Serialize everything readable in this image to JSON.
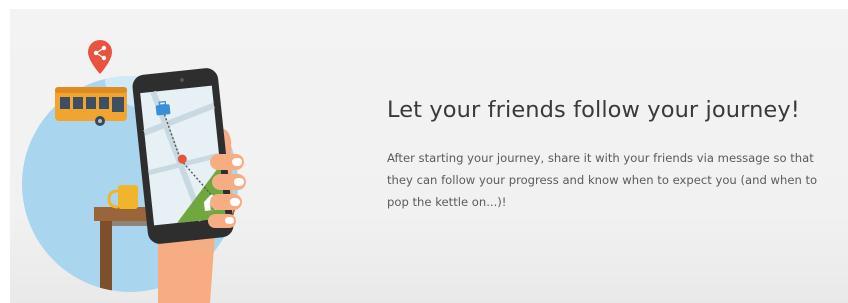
{
  "feature": {
    "headline": "Let your friends follow your journey!",
    "description": "After starting your journey, share it with your friends via message so that they can follow your progress and know when to expect you (and when to pop the kettle on...)!"
  },
  "icons": [
    "share-location-pin-icon",
    "bus-icon",
    "briefcase-icon",
    "home-icon",
    "location-dot-icon"
  ],
  "colors": {
    "background": "#f2f2f2",
    "headline": "#3a3a3a",
    "body_text": "#5b5b5b",
    "circle": "#a9d6ee",
    "bus": "#f2a431",
    "pin": "#e8533e",
    "route_green": "#6ea83e",
    "skin": "#f7ad84",
    "phone": "#2e2e2e",
    "table": "#8c5a33",
    "mug": "#f1b52d"
  }
}
